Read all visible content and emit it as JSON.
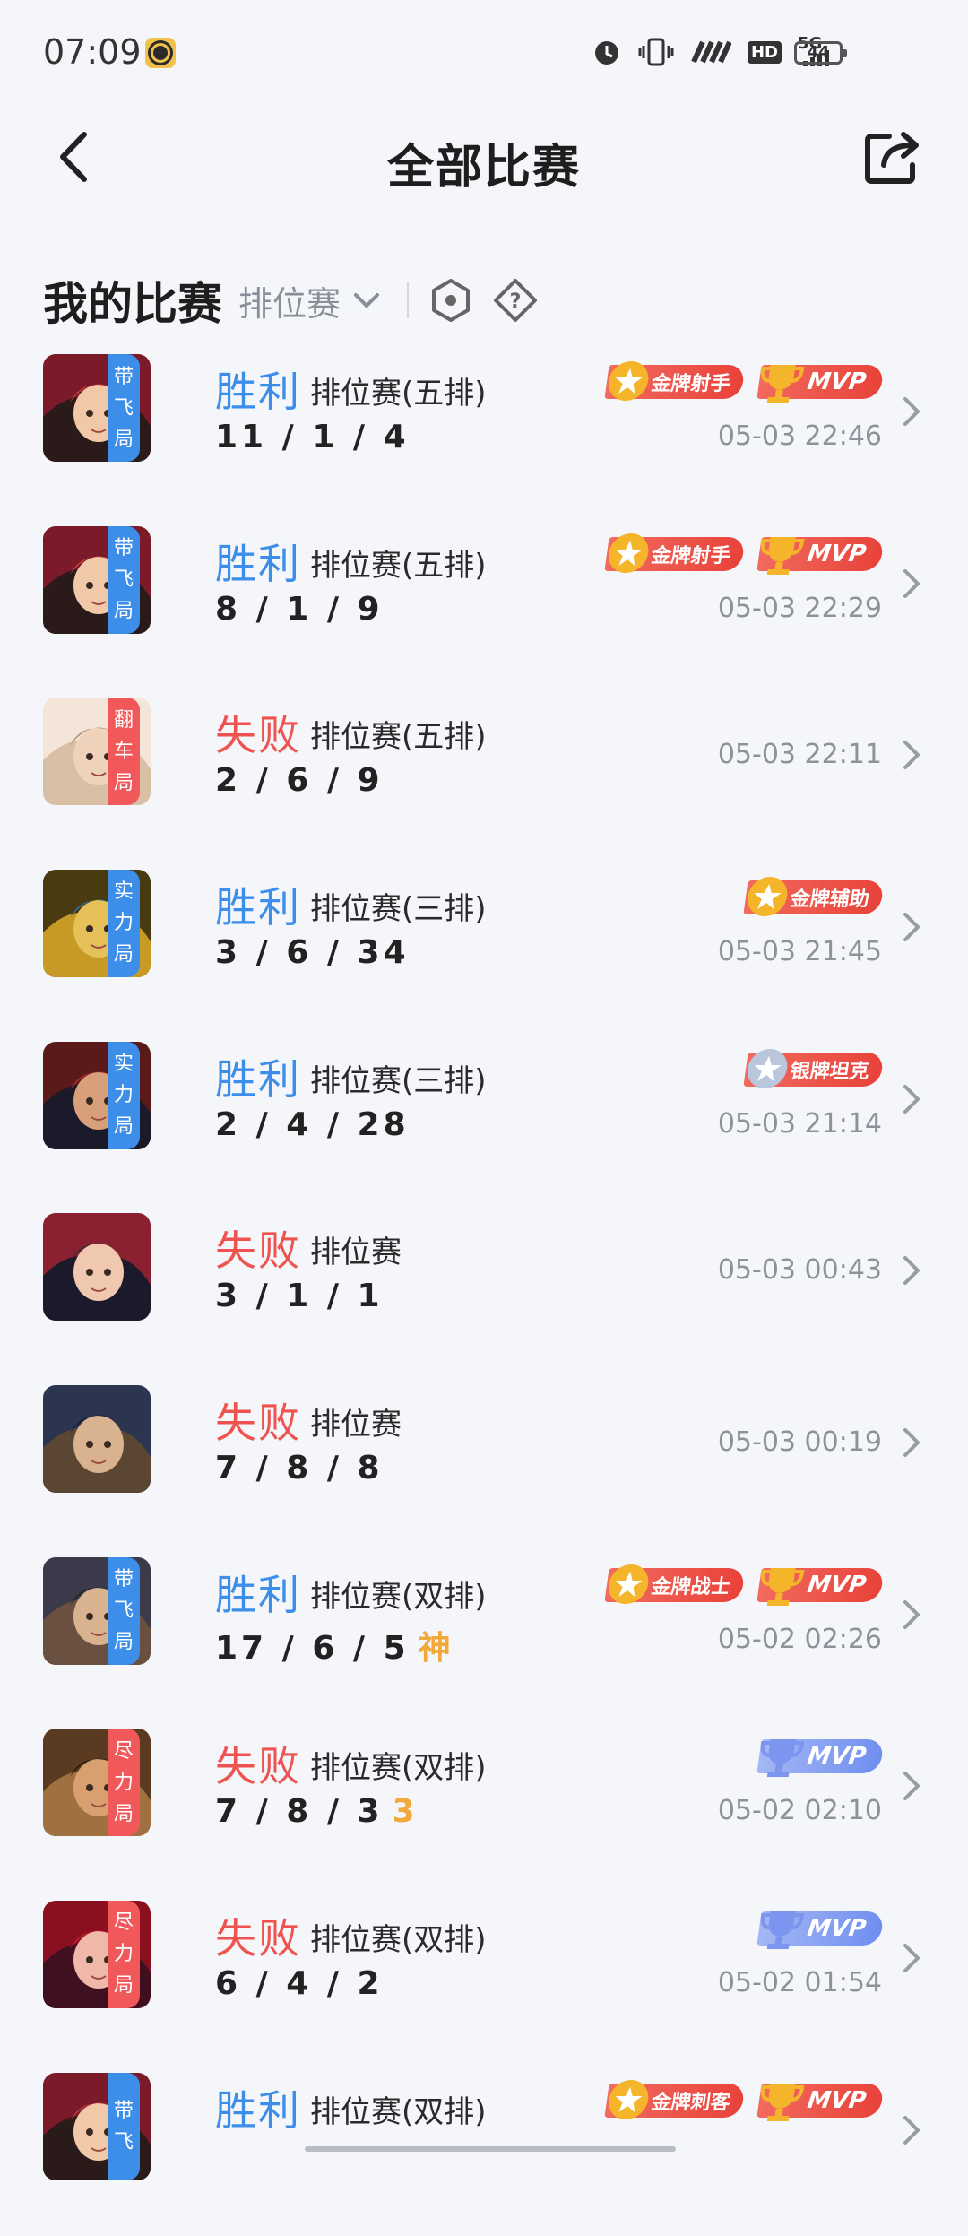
{
  "status_bar": {
    "time": "07:09",
    "battery": "44",
    "network": "5G",
    "hd": "HD",
    "icons": [
      "app-icon",
      "alarm-icon",
      "vibrate-icon",
      "signal-icon",
      "hd-icon",
      "5g-icon",
      "battery-icon"
    ]
  },
  "header": {
    "title": "全部比赛",
    "back_icon": "back-arrow-icon",
    "share_icon": "share-icon"
  },
  "filter": {
    "section_title": "我的比赛",
    "mode_selected": "排位赛",
    "icons": [
      "chevron-down-icon",
      "hex-eye-icon",
      "help-diamond-icon"
    ]
  },
  "colors": {
    "win": "#3d8ee8",
    "lose": "#ef5350",
    "tag_blue": "#3d8ee8",
    "tag_red": "#f0585a",
    "gold": "#f0a93a"
  },
  "matches": [
    {
      "tag": [
        "带",
        "飞",
        "局"
      ],
      "tag_color": "blue",
      "result": "胜利",
      "outcome": "win",
      "mode": "排位赛(五排)",
      "kda": "11 / 1 / 4",
      "extra": "",
      "badges": [
        {
          "text": "金牌射手",
          "style": "red"
        },
        {
          "text": "MVP",
          "style": "red-mvp"
        }
      ],
      "time": "05-03 22:46"
    },
    {
      "tag": [
        "带",
        "飞",
        "局"
      ],
      "tag_color": "blue",
      "result": "胜利",
      "outcome": "win",
      "mode": "排位赛(五排)",
      "kda": "8 / 1 / 9",
      "extra": "",
      "badges": [
        {
          "text": "金牌射手",
          "style": "red"
        },
        {
          "text": "MVP",
          "style": "red-mvp"
        }
      ],
      "time": "05-03 22:29"
    },
    {
      "tag": [
        "翻",
        "车",
        "局"
      ],
      "tag_color": "red",
      "result": "失败",
      "outcome": "lose",
      "mode": "排位赛(五排)",
      "kda": "2 / 6 / 9",
      "extra": "",
      "badges": [],
      "time": "05-03 22:11"
    },
    {
      "tag": [
        "实",
        "力",
        "局"
      ],
      "tag_color": "blue",
      "result": "胜利",
      "outcome": "win",
      "mode": "排位赛(三排)",
      "kda": "3 / 6 / 34",
      "extra": "",
      "badges": [
        {
          "text": "金牌辅助",
          "style": "red"
        }
      ],
      "time": "05-03 21:45"
    },
    {
      "tag": [
        "实",
        "力",
        "局"
      ],
      "tag_color": "blue",
      "result": "胜利",
      "outcome": "win",
      "mode": "排位赛(三排)",
      "kda": "2 / 4 / 28",
      "extra": "",
      "badges": [
        {
          "text": "银牌坦克",
          "style": "red-silver"
        }
      ],
      "time": "05-03 21:14"
    },
    {
      "tag": [],
      "tag_color": "",
      "result": "失败",
      "outcome": "lose",
      "mode": "排位赛",
      "kda": "3 / 1 / 1",
      "extra": "",
      "badges": [],
      "time": "05-03 00:43"
    },
    {
      "tag": [],
      "tag_color": "",
      "result": "失败",
      "outcome": "lose",
      "mode": "排位赛",
      "kda": "7 / 8 / 8",
      "extra": "",
      "badges": [],
      "time": "05-03 00:19"
    },
    {
      "tag": [
        "带",
        "飞",
        "局"
      ],
      "tag_color": "blue",
      "result": "胜利",
      "outcome": "win",
      "mode": "排位赛(双排)",
      "kda": "17 / 6 / 5",
      "extra": "神",
      "badges": [
        {
          "text": "金牌战士",
          "style": "red"
        },
        {
          "text": "MVP",
          "style": "red-mvp"
        }
      ],
      "time": "05-02 02:26"
    },
    {
      "tag": [
        "尽",
        "力",
        "局"
      ],
      "tag_color": "red",
      "result": "失败",
      "outcome": "lose",
      "mode": "排位赛(双排)",
      "kda": "7 / 8 / 3",
      "extra": "3",
      "badges": [
        {
          "text": "MVP",
          "style": "blue-mvp"
        }
      ],
      "time": "05-02 02:10"
    },
    {
      "tag": [
        "尽",
        "力",
        "局"
      ],
      "tag_color": "red",
      "result": "失败",
      "outcome": "lose",
      "mode": "排位赛(双排)",
      "kda": "6 / 4 / 2",
      "extra": "",
      "badges": [
        {
          "text": "MVP",
          "style": "blue-mvp"
        }
      ],
      "time": "05-02 01:54"
    },
    {
      "tag": [
        "带",
        "飞"
      ],
      "tag_color": "blue",
      "result": "胜利",
      "outcome": "win",
      "mode": "排位赛(双排)",
      "kda": "",
      "extra": "",
      "badges": [
        {
          "text": "金牌刺客",
          "style": "red"
        },
        {
          "text": "MVP",
          "style": "red-mvp"
        }
      ],
      "time": ""
    }
  ]
}
